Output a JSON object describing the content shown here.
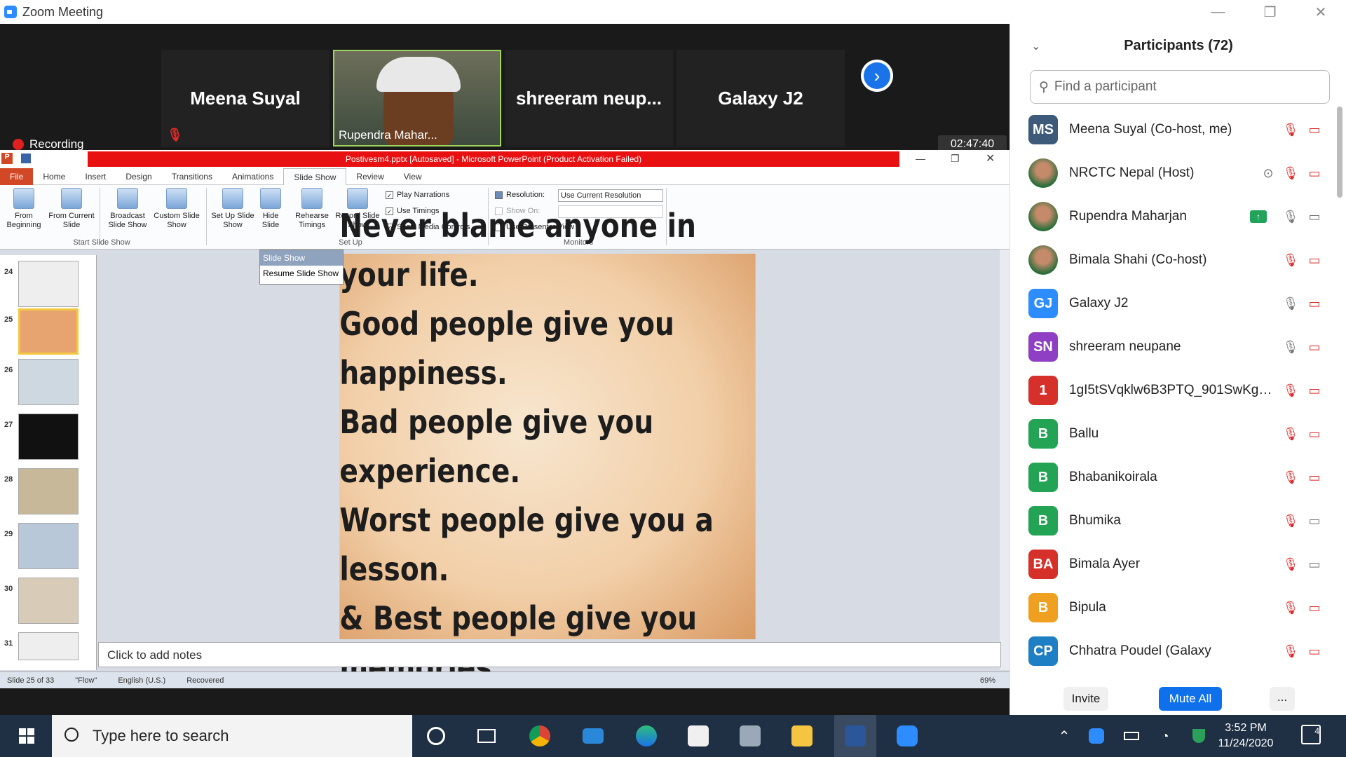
{
  "window": {
    "title": "Zoom Meeting"
  },
  "video_strip": {
    "tiles": [
      {
        "name": "Meena Suyal"
      },
      {
        "name": "Rupendra Mahar..."
      },
      {
        "name": "shreeram  neup..."
      },
      {
        "name": "Galaxy J2"
      }
    ],
    "recording_label": "Recording",
    "timer": "02:47:40"
  },
  "ppt": {
    "title": "Postivesm4.pptx [Autosaved] - Microsoft PowerPoint (Product Activation Failed)",
    "tabs": [
      "File",
      "Home",
      "Insert",
      "Design",
      "Transitions",
      "Animations",
      "Slide Show",
      "Review",
      "View"
    ],
    "active_tab": "Slide Show",
    "ribbon": {
      "buttons": [
        {
          "label": "From Beginning"
        },
        {
          "label": "From Current Slide"
        },
        {
          "label": "Broadcast Slide Show"
        },
        {
          "label": "Custom Slide Show"
        },
        {
          "label": "Set Up Slide Show"
        },
        {
          "label": "Hide Slide"
        },
        {
          "label": "Rehearse Timings"
        },
        {
          "label": "Record Slide Show"
        }
      ],
      "groups": [
        "Start Slide Show",
        "Set Up",
        "Monitors"
      ],
      "checks": [
        "Play Narrations",
        "Use Timings",
        "Show Media Controls",
        "Use Presenter View"
      ],
      "resolution_label": "Resolution:",
      "resolution_value": "Use Current Resolution",
      "show_on_label": "Show On:"
    },
    "slide_numbers": [
      "24",
      "25",
      "26",
      "27",
      "28",
      "29",
      "30",
      "31"
    ],
    "slideshow_popup": {
      "title": "Slide Show",
      "item": "Resume Slide Show"
    },
    "slide_text": [
      "Never blame anyone in your life.",
      "Good people give you happiness.",
      "Bad people give you experience.",
      "Worst people give you a lesson.",
      "& Best people give you memories."
    ],
    "notes_placeholder": "Click to add notes",
    "status": {
      "slide": "Slide 25 of 33",
      "theme": "\"Flow\"",
      "language": "English (U.S.)",
      "state": "Recovered",
      "zoom": "69%"
    }
  },
  "participants": {
    "title": "Participants (72)",
    "search_placeholder": "Find a participant",
    "list": [
      {
        "initials": "MS",
        "name": "Meena Suyal (Co-host, me)",
        "color": "#3d5a7a"
      },
      {
        "initials": "",
        "name": "NRCTC Nepal (Host)",
        "color": "#2a6e3a"
      },
      {
        "initials": "",
        "name": "Rupendra Maharjan",
        "color": "#8a5a3a"
      },
      {
        "initials": "",
        "name": "Bimala Shahi (Co-host)",
        "color": "#a06a4a"
      },
      {
        "initials": "GJ",
        "name": "Galaxy J2",
        "color": "#2d8cff"
      },
      {
        "initials": "SN",
        "name": "shreeram neupane",
        "color": "#8e3fc4"
      },
      {
        "initials": "1",
        "name": "1gI5tSVqklw6B3PTQ_901SwKgr...",
        "color": "#d6302a"
      },
      {
        "initials": "B",
        "name": "Ballu",
        "color": "#23a455"
      },
      {
        "initials": "B",
        "name": "Bhabanikoirala",
        "color": "#23a455"
      },
      {
        "initials": "B",
        "name": "Bhumika",
        "color": "#23a455"
      },
      {
        "initials": "BA",
        "name": "Bimala Ayer",
        "color": "#d6302a"
      },
      {
        "initials": "B",
        "name": "Bipula",
        "color": "#f0a020"
      },
      {
        "initials": "CP",
        "name": "Chhatra Poudel (Galaxy",
        "color": "#1f7fc4"
      }
    ],
    "invite_label": "Invite",
    "mute_all_label": "Mute All",
    "more_label": "..."
  },
  "taskbar": {
    "search_placeholder": "Type here to search",
    "time": "3:52 PM",
    "date": "11/24/2020",
    "notifications": "4"
  }
}
